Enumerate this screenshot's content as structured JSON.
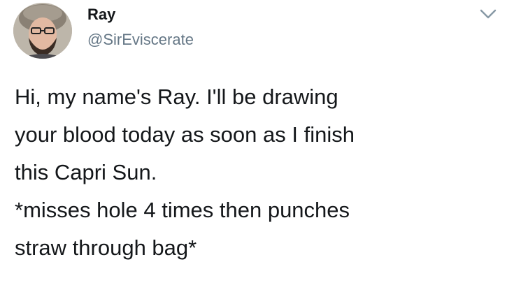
{
  "author": {
    "display_name": "Ray",
    "handle": "@SirEviscerate",
    "avatar_icon": "profile-photo"
  },
  "menu": {
    "icon": "chevron-down-icon"
  },
  "tweet": {
    "lines": [
      "Hi, my name's Ray. I'll be drawing",
      "your blood today as soon as I finish",
      "this Capri Sun.",
      "*misses hole 4 times then punches",
      "straw through bag*"
    ]
  },
  "colors": {
    "text": "#14171a",
    "secondary_text": "#657786",
    "background": "#ffffff"
  }
}
